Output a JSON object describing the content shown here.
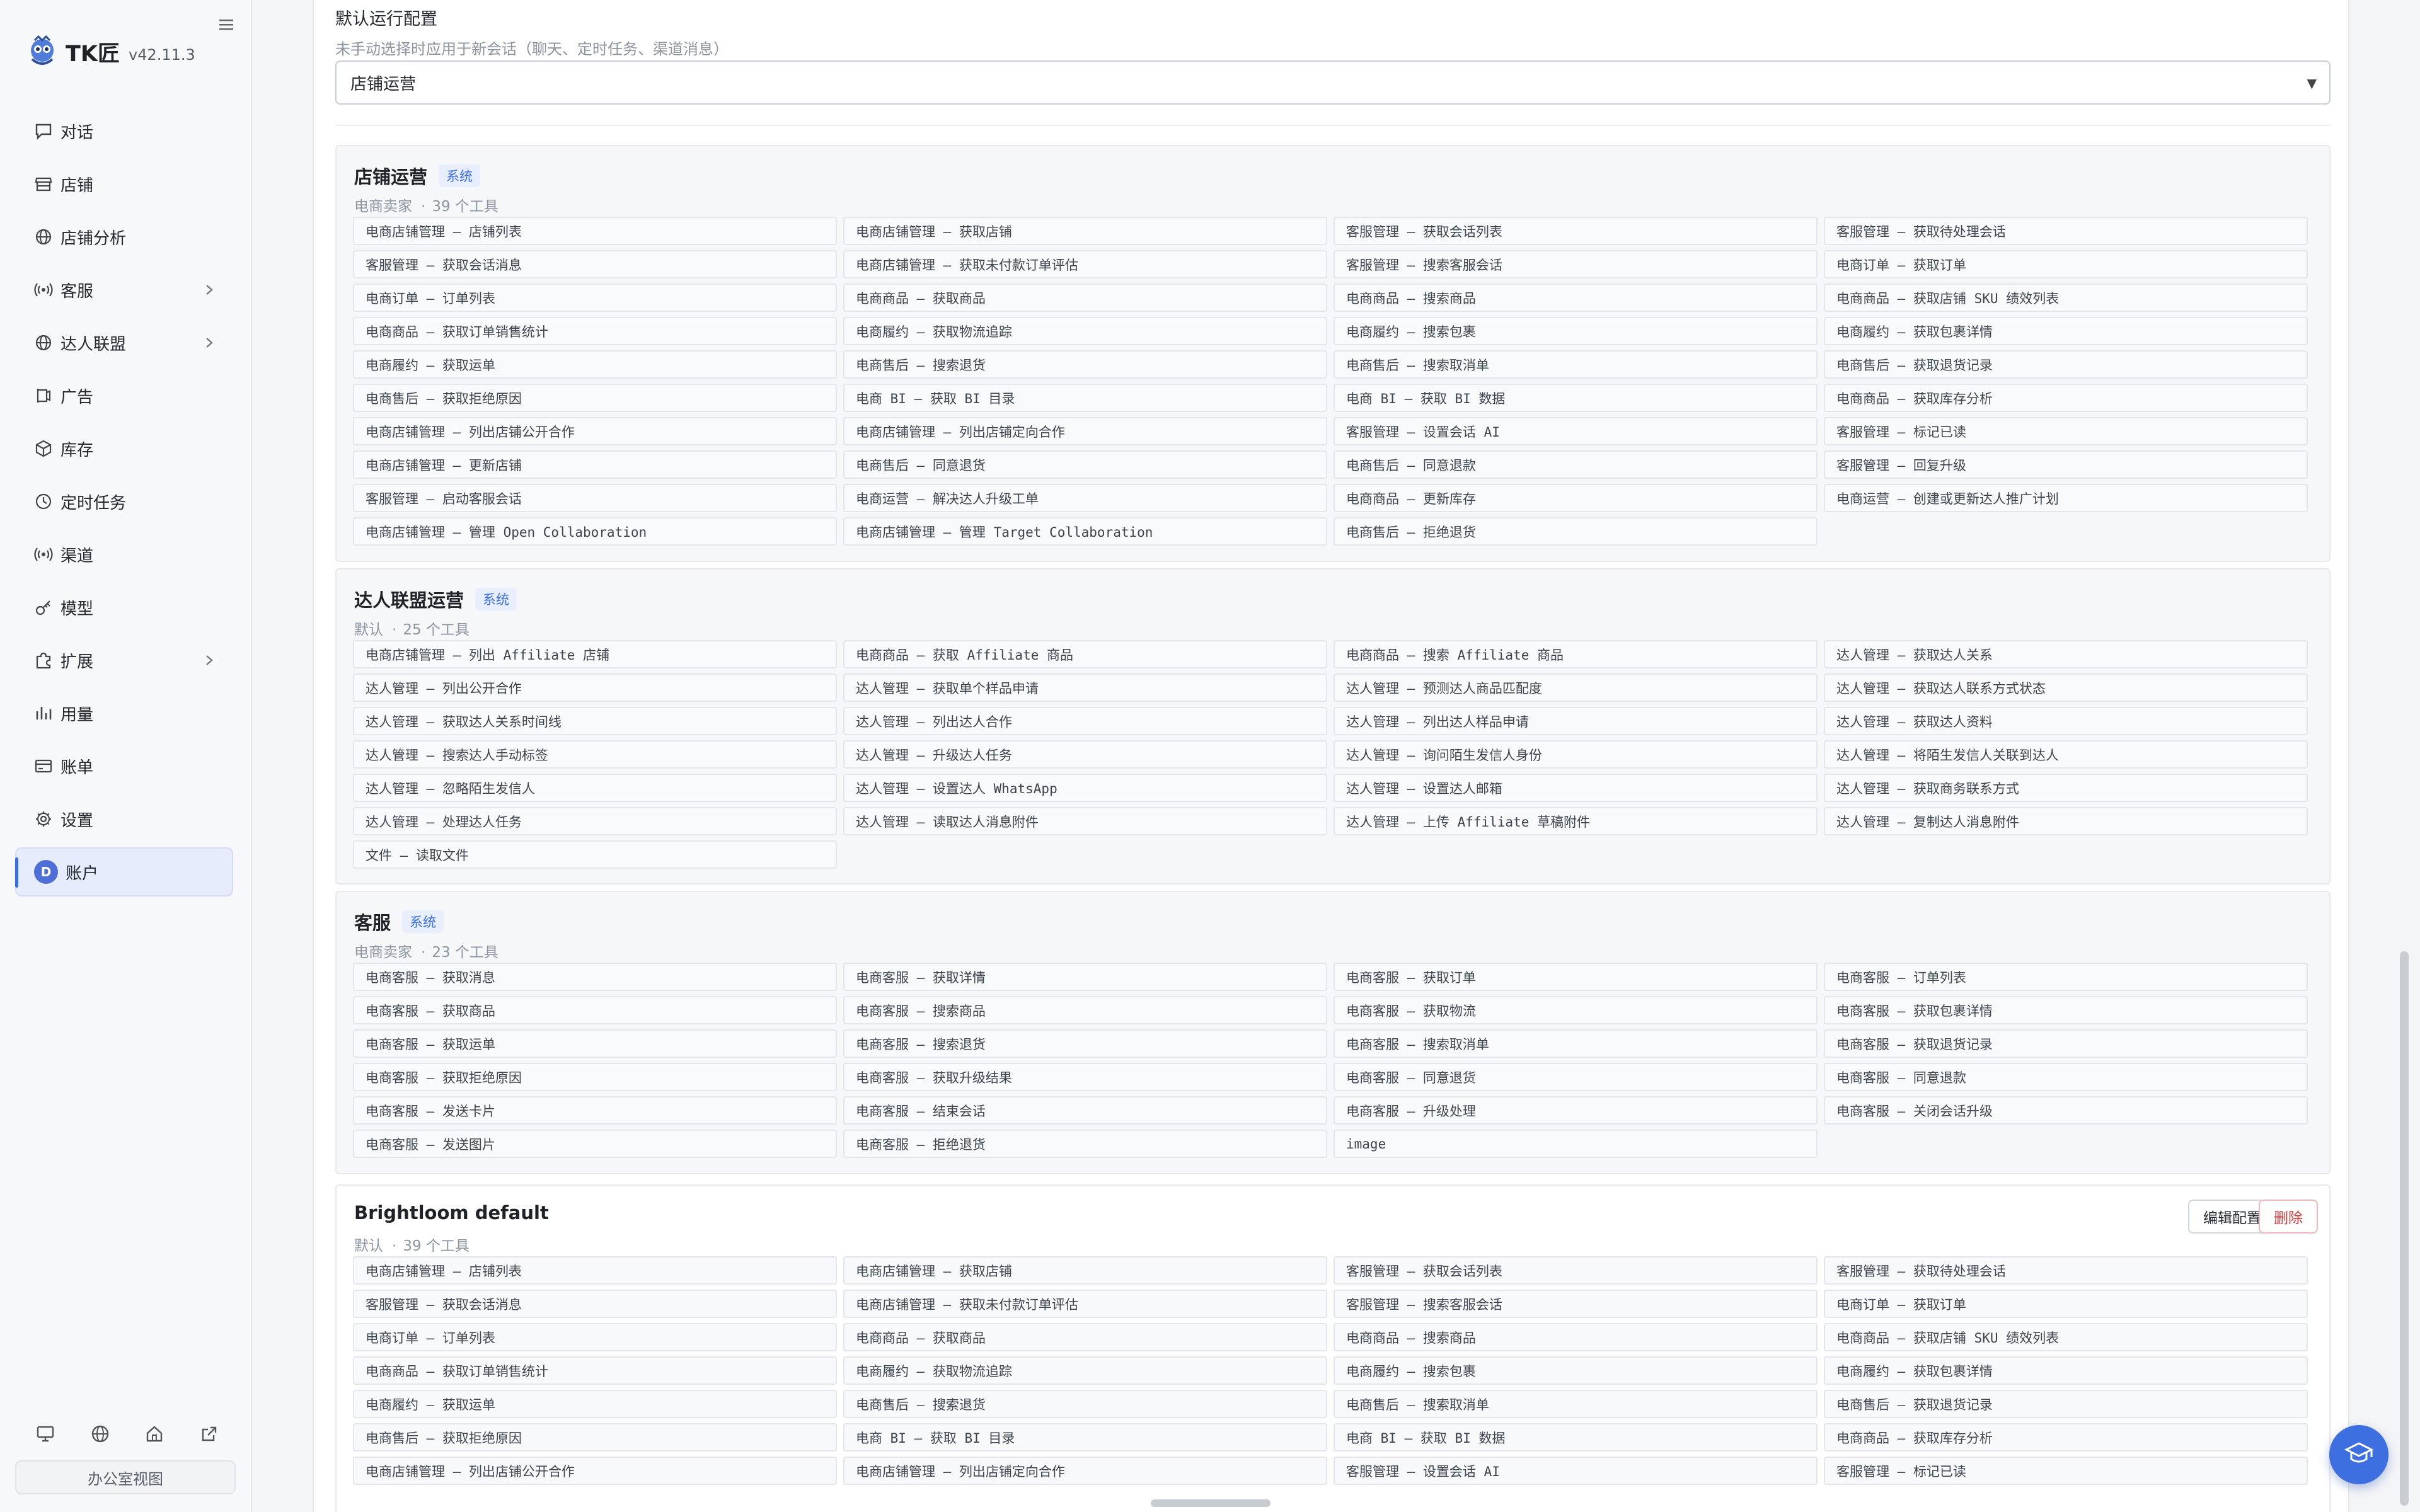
{
  "app": {
    "name": "TK匠",
    "version": "v42.11.3"
  },
  "nav": [
    {
      "label": "对话",
      "icon": "chat-icon"
    },
    {
      "label": "店铺",
      "icon": "store-icon"
    },
    {
      "label": "店铺分析",
      "icon": "globe-icon"
    },
    {
      "label": "客服",
      "icon": "broadcast-icon",
      "expandable": true
    },
    {
      "label": "达人联盟",
      "icon": "globe-icon",
      "expandable": true
    },
    {
      "label": "广告",
      "icon": "megaphone-icon"
    },
    {
      "label": "库存",
      "icon": "box-icon"
    },
    {
      "label": "定时任务",
      "icon": "clock-icon"
    },
    {
      "label": "渠道",
      "icon": "broadcast-icon"
    },
    {
      "label": "模型",
      "icon": "key-icon"
    },
    {
      "label": "扩展",
      "icon": "puzzle-icon",
      "expandable": true
    },
    {
      "label": "用量",
      "icon": "bar-chart-icon"
    },
    {
      "label": "账单",
      "icon": "card-icon"
    },
    {
      "label": "设置",
      "icon": "gear-icon"
    },
    {
      "label": "账户",
      "icon": "avatar",
      "avatar_letter": "D",
      "active": true
    }
  ],
  "bottom": {
    "office_view": "办公室视图"
  },
  "config": {
    "title": "默认运行配置",
    "description": "未手动选择时应用于新会话（聊天、定时任务、渠道消息）",
    "selected": "店铺运营"
  },
  "actions": {
    "edit": "编辑配置",
    "delete": "删除"
  },
  "groups": [
    {
      "name": "店铺运营",
      "badge": "系统",
      "source": "电商卖家",
      "count": "39 个工具",
      "tools": [
        "电商店铺管理 — 店铺列表",
        "电商店铺管理 — 获取店铺",
        "客服管理 — 获取会话列表",
        "客服管理 — 获取待处理会话",
        "客服管理 — 获取会话消息",
        "电商店铺管理 — 获取未付款订单评估",
        "客服管理 — 搜索客服会话",
        "电商订单 — 获取订单",
        "电商订单 — 订单列表",
        "电商商品 — 获取商品",
        "电商商品 — 搜索商品",
        "电商商品 — 获取店铺 SKU 绩效列表",
        "电商商品 — 获取订单销售统计",
        "电商履约 — 获取物流追踪",
        "电商履约 — 搜索包裹",
        "电商履约 — 获取包裹详情",
        "电商履约 — 获取运单",
        "电商售后 — 搜索退货",
        "电商售后 — 搜索取消单",
        "电商售后 — 获取退货记录",
        "电商售后 — 获取拒绝原因",
        "电商 BI — 获取 BI 目录",
        "电商 BI — 获取 BI 数据",
        "电商商品 — 获取库存分析",
        "电商店铺管理 — 列出店铺公开合作",
        "电商店铺管理 — 列出店铺定向合作",
        "客服管理 — 设置会话 AI",
        "客服管理 — 标记已读",
        "电商店铺管理 — 更新店铺",
        "电商售后 — 同意退货",
        "电商售后 — 同意退款",
        "客服管理 — 回复升级",
        "客服管理 — 启动客服会话",
        "电商运营 — 解决达人升级工单",
        "电商商品 — 更新库存",
        "电商运营 — 创建或更新达人推广计划",
        "电商店铺管理 — 管理 Open Collaboration",
        "电商店铺管理 — 管理 Target Collaboration",
        "电商售后 — 拒绝退货"
      ]
    },
    {
      "name": "达人联盟运营",
      "badge": "系统",
      "source": "默认",
      "count": "25 个工具",
      "tools": [
        "电商店铺管理 — 列出 Affiliate 店铺",
        "电商商品 — 获取 Affiliate 商品",
        "电商商品 — 搜索 Affiliate 商品",
        "达人管理 — 获取达人关系",
        "达人管理 — 列出公开合作",
        "达人管理 — 获取单个样品申请",
        "达人管理 — 预测达人商品匹配度",
        "达人管理 — 获取达人联系方式状态",
        "达人管理 — 获取达人关系时间线",
        "达人管理 — 列出达人合作",
        "达人管理 — 列出达人样品申请",
        "达人管理 — 获取达人资料",
        "达人管理 — 搜索达人手动标签",
        "达人管理 — 升级达人任务",
        "达人管理 — 询问陌生发信人身份",
        "达人管理 — 将陌生发信人关联到达人",
        "达人管理 — 忽略陌生发信人",
        "达人管理 — 设置达人 WhatsApp",
        "达人管理 — 设置达人邮箱",
        "达人管理 — 获取商务联系方式",
        "达人管理 — 处理达人任务",
        "达人管理 — 读取达人消息附件",
        "达人管理 — 上传 Affiliate 草稿附件",
        "达人管理 — 复制达人消息附件",
        "文件 — 读取文件"
      ]
    },
    {
      "name": "客服",
      "badge": "系统",
      "source": "电商卖家",
      "count": "23 个工具",
      "tools": [
        "电商客服 — 获取消息",
        "电商客服 — 获取详情",
        "电商客服 — 获取订单",
        "电商客服 — 订单列表",
        "电商客服 — 获取商品",
        "电商客服 — 搜索商品",
        "电商客服 — 获取物流",
        "电商客服 — 获取包裹详情",
        "电商客服 — 获取运单",
        "电商客服 — 搜索退货",
        "电商客服 — 搜索取消单",
        "电商客服 — 获取退货记录",
        "电商客服 — 获取拒绝原因",
        "电商客服 — 获取升级结果",
        "电商客服 — 同意退货",
        "电商客服 — 同意退款",
        "电商客服 — 发送卡片",
        "电商客服 — 结束会话",
        "电商客服 — 升级处理",
        "电商客服 — 关闭会话升级",
        "电商客服 — 发送图片",
        "电商客服 — 拒绝退货",
        "image"
      ]
    },
    {
      "name": "Brightloom default",
      "badge": "",
      "source": "默认",
      "count": "39 个工具",
      "tools": [
        "电商店铺管理 — 店铺列表",
        "电商店铺管理 — 获取店铺",
        "客服管理 — 获取会话列表",
        "客服管理 — 获取待处理会话",
        "客服管理 — 获取会话消息",
        "电商店铺管理 — 获取未付款订单评估",
        "客服管理 — 搜索客服会话",
        "电商订单 — 获取订单",
        "电商订单 — 订单列表",
        "电商商品 — 获取商品",
        "电商商品 — 搜索商品",
        "电商商品 — 获取店铺 SKU 绩效列表",
        "电商商品 — 获取订单销售统计",
        "电商履约 — 获取物流追踪",
        "电商履约 — 搜索包裹",
        "电商履约 — 获取包裹详情",
        "电商履约 — 获取运单",
        "电商售后 — 搜索退货",
        "电商售后 — 搜索取消单",
        "电商售后 — 获取退货记录",
        "电商售后 — 获取拒绝原因",
        "电商 BI — 获取 BI 目录",
        "电商 BI — 获取 BI 数据",
        "电商商品 — 获取库存分析",
        "电商店铺管理 — 列出店铺公开合作",
        "电商店铺管理 — 列出店铺定向合作",
        "客服管理 — 设置会话 AI",
        "客服管理 — 标记已读"
      ]
    }
  ]
}
